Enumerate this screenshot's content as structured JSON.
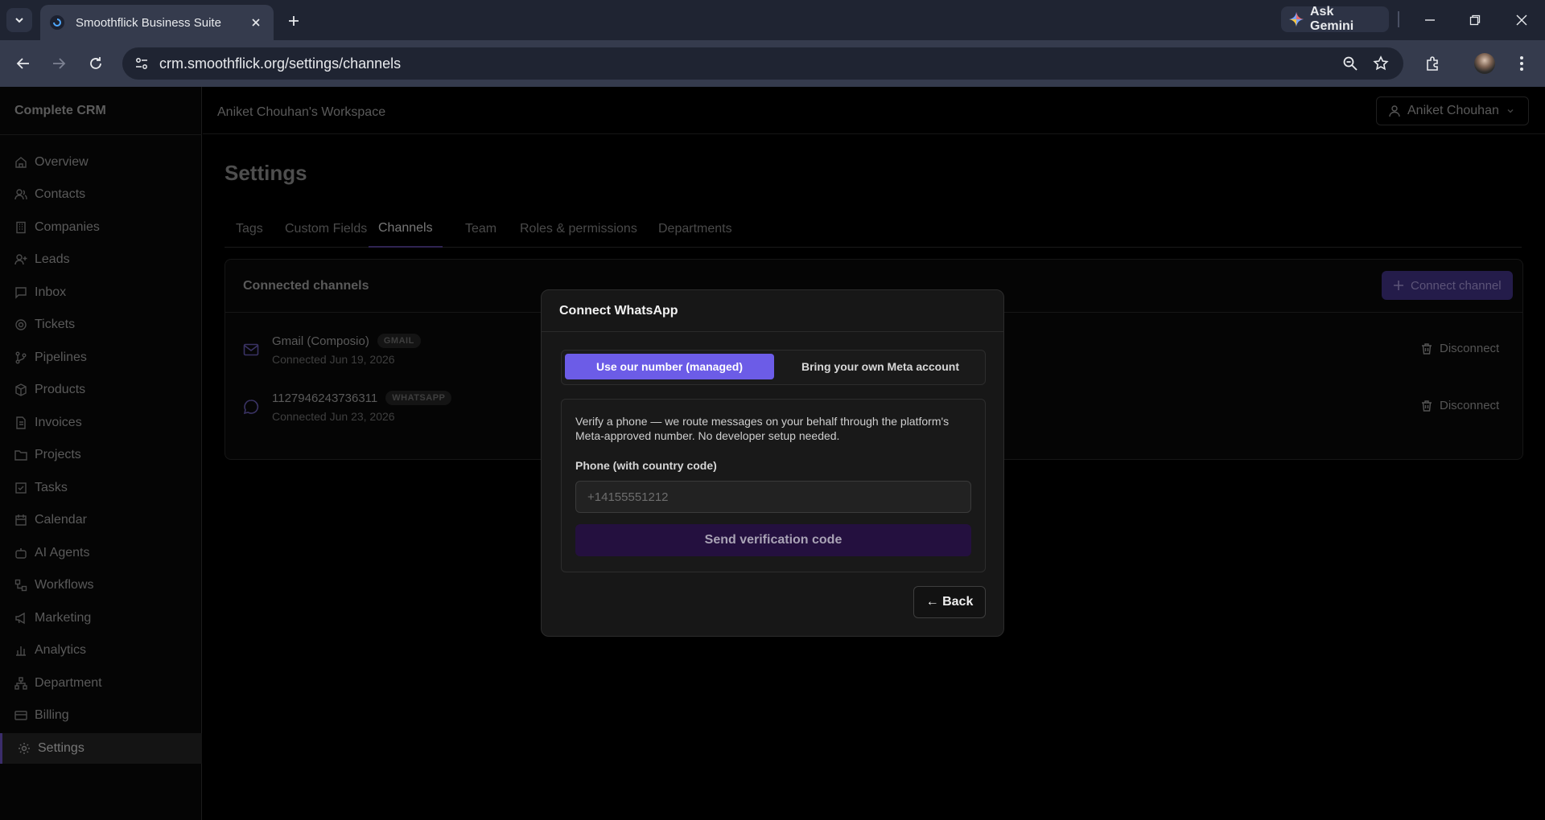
{
  "browser": {
    "tab_title": "Smoothflick Business Suite",
    "url_host": "crm.smoothflick.org",
    "url_path": "/settings/channels",
    "gemini_label": "Ask Gemini"
  },
  "sidebar": {
    "brand": "Complete CRM",
    "items": [
      {
        "label": "Overview",
        "icon": "home-icon"
      },
      {
        "label": "Contacts",
        "icon": "users-icon"
      },
      {
        "label": "Companies",
        "icon": "building-icon"
      },
      {
        "label": "Leads",
        "icon": "user-plus-icon"
      },
      {
        "label": "Inbox",
        "icon": "message-square-icon"
      },
      {
        "label": "Tickets",
        "icon": "lifebuoy-icon"
      },
      {
        "label": "Pipelines",
        "icon": "git-branch-icon"
      },
      {
        "label": "Products",
        "icon": "package-icon"
      },
      {
        "label": "Invoices",
        "icon": "file-text-icon"
      },
      {
        "label": "Projects",
        "icon": "folder-icon"
      },
      {
        "label": "Tasks",
        "icon": "check-square-icon"
      },
      {
        "label": "Calendar",
        "icon": "calendar-icon"
      },
      {
        "label": "AI Agents",
        "icon": "bot-icon"
      },
      {
        "label": "Workflows",
        "icon": "workflow-icon"
      },
      {
        "label": "Marketing",
        "icon": "megaphone-icon"
      },
      {
        "label": "Analytics",
        "icon": "bar-chart-icon"
      },
      {
        "label": "Department",
        "icon": "network-icon"
      },
      {
        "label": "Billing",
        "icon": "credit-card-icon"
      },
      {
        "label": "Settings",
        "icon": "gear-icon"
      }
    ],
    "active_item": "Settings"
  },
  "header": {
    "workspace": "Aniket Chouhan's Workspace",
    "user_name": "Aniket Chouhan"
  },
  "settings": {
    "title": "Settings",
    "tabs": [
      "Tags",
      "Custom Fields",
      "Channels",
      "Team",
      "Roles & permissions",
      "Departments"
    ],
    "active_tab": "Channels"
  },
  "channels": {
    "card_title": "Connected channels",
    "connect_label": "Connect channel",
    "disconnect_label": "Disconnect",
    "items": [
      {
        "name": "Gmail (Composio)",
        "badge": "GMAIL",
        "date": "Connected Jun 19, 2026",
        "icon": "mail-icon"
      },
      {
        "name": "1127946243736311",
        "badge": "WHATSAPP",
        "date": "Connected Jun 23, 2026",
        "icon": "chat-bubble-icon"
      }
    ]
  },
  "modal": {
    "title": "Connect WhatsApp",
    "option_managed": "Use our number (managed)",
    "option_own": "Bring your own Meta account",
    "description": "Verify a phone — we route messages on your behalf through the platform's Meta-approved number. No developer setup needed.",
    "phone_label": "Phone (with country code)",
    "phone_placeholder": "+14155551212",
    "phone_value": "",
    "send_label": "Send verification code",
    "back_label": "← Back"
  },
  "colors": {
    "accent": "#6c5ce7",
    "send_button_bg": "#24103f"
  }
}
